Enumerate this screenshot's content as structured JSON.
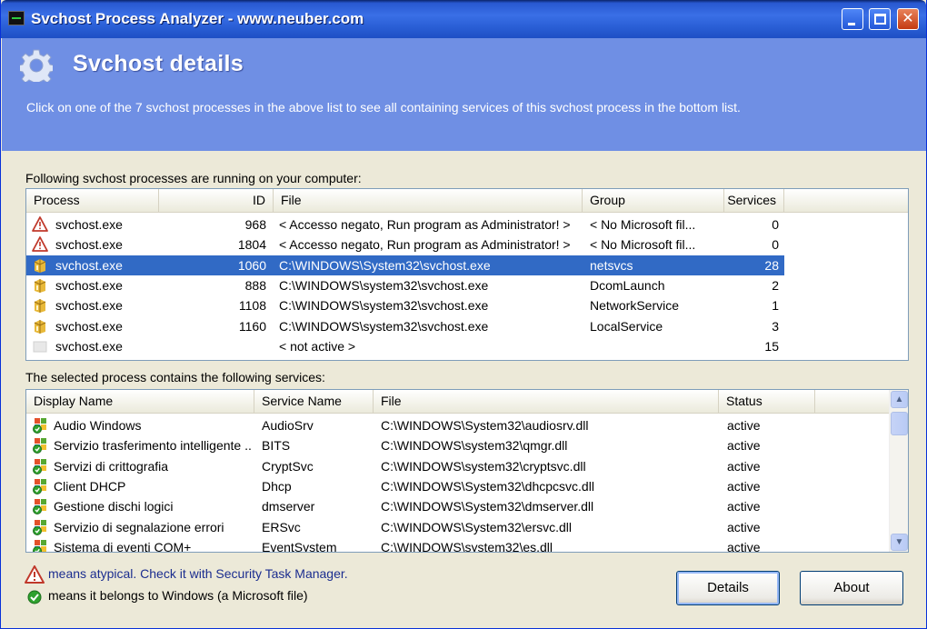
{
  "window": {
    "title": "Svchost Process Analyzer - www.neuber.com"
  },
  "banner": {
    "title": "Svchost details",
    "subtitle": "Click on one of the 7 svchost processes in the above list to see all containing services of this svchost process in the bottom list."
  },
  "processes_label": "Following svchost processes are running on your computer:",
  "process_list": {
    "columns": [
      "Process",
      "ID",
      "File",
      "Group",
      "Services"
    ],
    "rows": [
      {
        "icon": "warning-icon",
        "process": "svchost.exe",
        "id": "968",
        "file": "< Accesso negato, Run program as Administrator! >",
        "group": "< No Microsoft fil...",
        "services": "0",
        "selected": false
      },
      {
        "icon": "warning-icon",
        "process": "svchost.exe",
        "id": "1804",
        "file": "< Accesso negato, Run program as Administrator! >",
        "group": "< No Microsoft fil...",
        "services": "0",
        "selected": false
      },
      {
        "icon": "cube-icon",
        "process": "svchost.exe",
        "id": "1060",
        "file": "C:\\WINDOWS\\System32\\svchost.exe",
        "group": "netsvcs",
        "services": "28",
        "selected": true
      },
      {
        "icon": "cube-icon",
        "process": "svchost.exe",
        "id": "888",
        "file": "C:\\WINDOWS\\system32\\svchost.exe",
        "group": "DcomLaunch",
        "services": "2",
        "selected": false
      },
      {
        "icon": "cube-icon",
        "process": "svchost.exe",
        "id": "1108",
        "file": "C:\\WINDOWS\\system32\\svchost.exe",
        "group": "NetworkService",
        "services": "1",
        "selected": false
      },
      {
        "icon": "cube-icon",
        "process": "svchost.exe",
        "id": "1160",
        "file": "C:\\WINDOWS\\system32\\svchost.exe",
        "group": "LocalService",
        "services": "3",
        "selected": false
      },
      {
        "icon": "blank-icon",
        "process": "svchost.exe",
        "id": "",
        "file": "< not active >",
        "group": "",
        "services": "15",
        "selected": false
      }
    ]
  },
  "services_label": "The selected process contains the following services:",
  "service_list": {
    "columns": [
      "Display Name",
      "Service Name",
      "File",
      "Status"
    ],
    "rows": [
      {
        "display": "Audio Windows",
        "service": "AudioSrv",
        "file": "C:\\WINDOWS\\System32\\audiosrv.dll",
        "status": "active"
      },
      {
        "display": "Servizio trasferimento intelligente ...",
        "service": "BITS",
        "file": "C:\\WINDOWS\\system32\\qmgr.dll",
        "status": "active"
      },
      {
        "display": "Servizi di crittografia",
        "service": "CryptSvc",
        "file": "C:\\WINDOWS\\system32\\cryptsvc.dll",
        "status": "active"
      },
      {
        "display": "Client DHCP",
        "service": "Dhcp",
        "file": "C:\\WINDOWS\\System32\\dhcpcsvc.dll",
        "status": "active"
      },
      {
        "display": "Gestione dischi logici",
        "service": "dmserver",
        "file": "C:\\WINDOWS\\System32\\dmserver.dll",
        "status": "active"
      },
      {
        "display": "Servizio di segnalazione errori",
        "service": "ERSvc",
        "file": "C:\\WINDOWS\\System32\\ersvc.dll",
        "status": "active"
      },
      {
        "display": "Sistema di eventi COM+",
        "service": "EventSystem",
        "file": "C:\\WINDOWS\\system32\\es.dll",
        "status": "active"
      }
    ]
  },
  "legend": {
    "atypical": "means atypical. Check it with Security Task Manager.",
    "windows": "means it belongs to Windows (a Microsoft file)"
  },
  "buttons": {
    "details": "Details",
    "about": "About"
  },
  "colors": {
    "banner": "#6f8fe4",
    "selection": "#316ac5",
    "legend_link": "#1b2d8f"
  }
}
